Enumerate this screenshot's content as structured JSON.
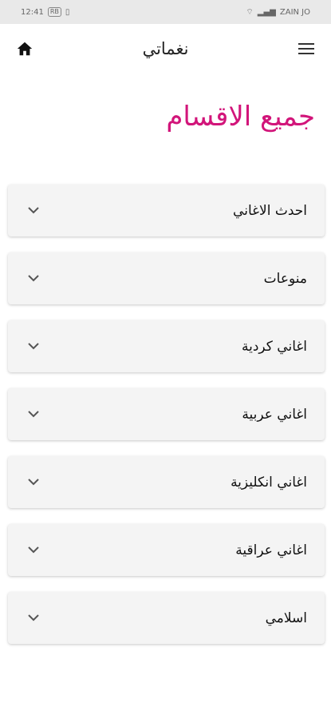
{
  "status": {
    "time": "12:41",
    "badge": "RB",
    "carrier": "ZAIN JO"
  },
  "appbar": {
    "title": "نغماتي"
  },
  "page": {
    "title": "جميع الاقسام"
  },
  "categories": [
    {
      "label": "احدث الاغاني"
    },
    {
      "label": "منوعات"
    },
    {
      "label": "اغاني كردية"
    },
    {
      "label": "اغاني عربية"
    },
    {
      "label": "اغاني انكليزية"
    },
    {
      "label": "اغاني عراقية"
    },
    {
      "label": "اسلامي"
    }
  ],
  "colors": {
    "accent": "#d2157a",
    "card": "#f4f4f4",
    "statusbar": "#e9e9e9"
  },
  "icons": {
    "home": "home-icon",
    "menu": "menu-icon",
    "expand": "chevron-down-icon"
  }
}
